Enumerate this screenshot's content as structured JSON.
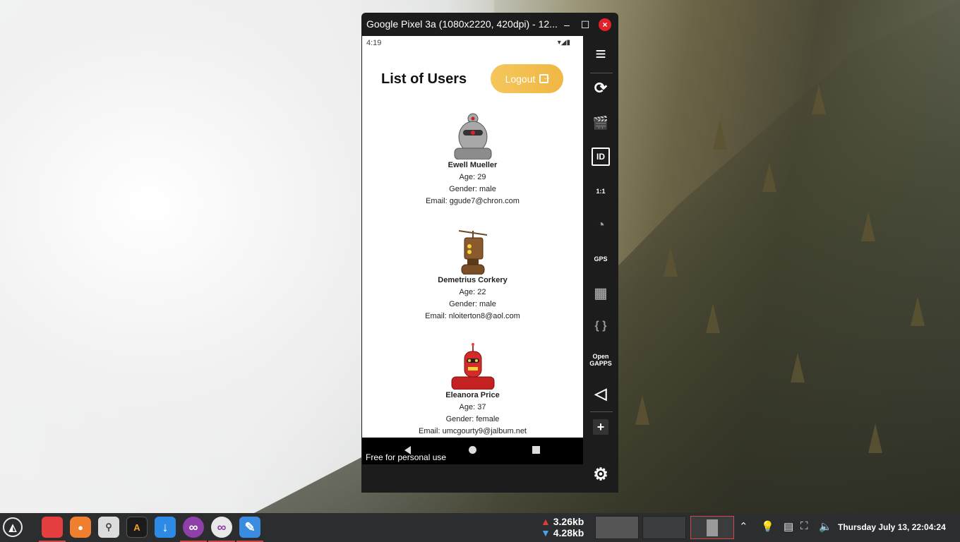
{
  "emulator": {
    "title": "Google Pixel 3a (1080x2220, 420dpi) - 12...",
    "minimize": "–",
    "maximize": "☐",
    "close": "×"
  },
  "phone": {
    "status_time": "4:19",
    "status_icons": "▾◢▮",
    "page_title": "List of Users",
    "logout_label": "Logout",
    "watermark": "Free for personal use",
    "users": [
      {
        "name": "Ewell Mueller",
        "age": "Age: 29",
        "gender": "Gender: male",
        "email": "Email: ggude7@chron.com",
        "avatar_color": "#9a9a9a"
      },
      {
        "name": "Demetrius Corkery",
        "age": "Age: 22",
        "gender": "Gender: male",
        "email": "Email: nloiterton8@aol.com",
        "avatar_color": "#8a5a2c"
      },
      {
        "name": "Eleanora Price",
        "age": "Age: 37",
        "gender": "Gender: female",
        "email": "Email: umcgourty9@jalbum.net",
        "avatar_color": "#d42a2a"
      }
    ]
  },
  "sidebar": {
    "items": [
      {
        "icon": "menu-icon",
        "glyph": "≡"
      },
      {
        "icon": "rotate-icon",
        "glyph": "⟳"
      },
      {
        "icon": "screen-record-icon",
        "glyph": "🎬"
      },
      {
        "icon": "id-icon",
        "glyph": "ID"
      },
      {
        "icon": "pixel-perfect-icon",
        "glyph": "1:1"
      },
      {
        "icon": "cast-icon",
        "glyph": "◔"
      },
      {
        "icon": "gps-icon",
        "glyph": "GPS"
      },
      {
        "icon": "media-icon",
        "glyph": "▦"
      },
      {
        "icon": "json-icon",
        "glyph": "{ }"
      },
      {
        "icon": "open-gapps-icon",
        "glyph": "Open GAPPS"
      },
      {
        "icon": "back-icon",
        "glyph": "◁"
      },
      {
        "icon": "add-icon",
        "glyph": "+"
      },
      {
        "icon": "settings-icon",
        "glyph": "⚙"
      }
    ]
  },
  "taskbar": {
    "net_up": "3.26kb",
    "net_down": "4.28kb",
    "clock": "Thursday July 13, 22:04:24",
    "apps": [
      {
        "icon": "start-menu-icon",
        "glyph": "◭",
        "color": "#3a3c3d"
      },
      {
        "icon": "files-icon",
        "glyph": "",
        "color": "#e53e3e"
      },
      {
        "icon": "firefox-icon",
        "glyph": "●",
        "color": "#f08030"
      },
      {
        "icon": "settings-toggle-icon",
        "glyph": "⚲",
        "color": "#dcdcdc"
      },
      {
        "icon": "text-editor-icon",
        "glyph": "A",
        "color": "#1b1b1b"
      },
      {
        "icon": "download-icon",
        "glyph": "↓",
        "color": "#2d8be5"
      },
      {
        "icon": "genymotion-icon",
        "glyph": "∞",
        "color": "#8e3fa8"
      },
      {
        "icon": "genymotion-player-icon",
        "glyph": "∞",
        "color": "#e8e8e8"
      },
      {
        "icon": "notes-icon",
        "glyph": "✎",
        "color": "#3a8ce0"
      }
    ]
  }
}
